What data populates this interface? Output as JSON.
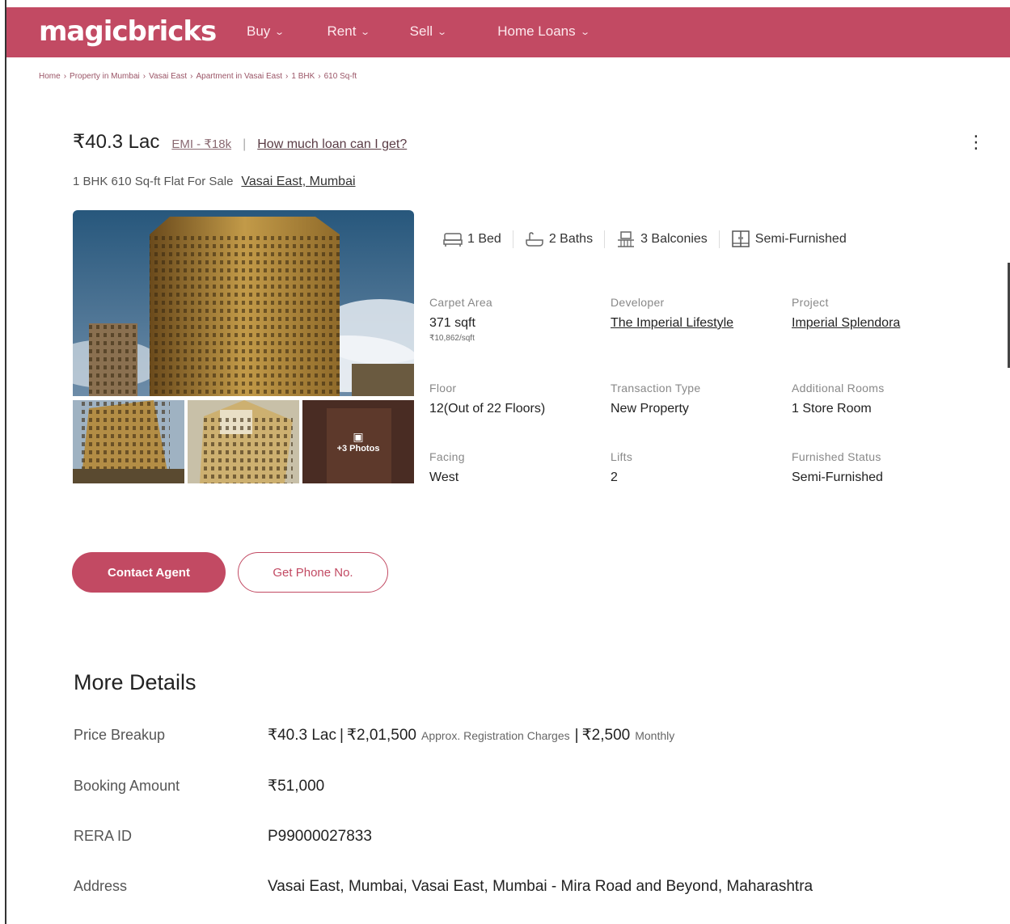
{
  "header": {
    "logo": "magicbricks",
    "nav": [
      {
        "label": "Buy"
      },
      {
        "label": "Rent"
      },
      {
        "label": "Sell"
      },
      {
        "label": "Home Loans"
      }
    ],
    "brand_color": "#c24a63"
  },
  "breadcrumb": [
    "Home",
    "Property in Mumbai",
    "Vasai East",
    "Apartment in Vasai East",
    "1 BHK",
    "610 Sq-ft"
  ],
  "listing": {
    "price": "₹40.3 Lac",
    "emi": "EMI - ₹18k",
    "loan_link": "How much loan can I get?",
    "subtitle": "1 BHK 610 Sq-ft Flat For Sale",
    "location": "Vasai East, Mumbai"
  },
  "gallery": {
    "more_photos": "+3 Photos"
  },
  "amenities": [
    {
      "label": "1 Bed",
      "icon": "bed-icon"
    },
    {
      "label": "2 Baths",
      "icon": "bath-icon"
    },
    {
      "label": "3 Balconies",
      "icon": "balcony-icon"
    },
    {
      "label": "Semi-Furnished",
      "icon": "wardrobe-icon"
    }
  ],
  "details": {
    "carpet_area": {
      "label": "Carpet Area",
      "value": "371 sqft",
      "sub": "₹10,862/sqft"
    },
    "developer": {
      "label": "Developer",
      "value": "The Imperial Lifestyle"
    },
    "project": {
      "label": "Project",
      "value": "Imperial Splendora"
    },
    "floor": {
      "label": "Floor",
      "value": "12(Out of 22 Floors)"
    },
    "transaction_type": {
      "label": "Transaction Type",
      "value": "New Property"
    },
    "additional_rooms": {
      "label": "Additional Rooms",
      "value": "1 Store Room"
    },
    "facing": {
      "label": "Facing",
      "value": "West"
    },
    "lifts": {
      "label": "Lifts",
      "value": "2"
    },
    "furnished_status": {
      "label": "Furnished Status",
      "value": "Semi-Furnished"
    }
  },
  "actions": {
    "contact_agent": "Contact Agent",
    "get_phone": "Get Phone No."
  },
  "more_details": {
    "title": "More Details",
    "price_breakup": {
      "label": "Price Breakup",
      "price": "₹40.3 Lac",
      "registration": "₹2,01,500",
      "registration_note": "Approx. Registration Charges",
      "monthly": "₹2,500",
      "monthly_note": "Monthly"
    },
    "booking_amount": {
      "label": "Booking Amount",
      "value": "₹51,000"
    },
    "rera_id": {
      "label": "RERA ID",
      "value": "P99000027833"
    },
    "address": {
      "label": "Address",
      "value": "Vasai East, Mumbai, Vasai East, Mumbai - Mira Road and Beyond, Maharashtra"
    }
  }
}
